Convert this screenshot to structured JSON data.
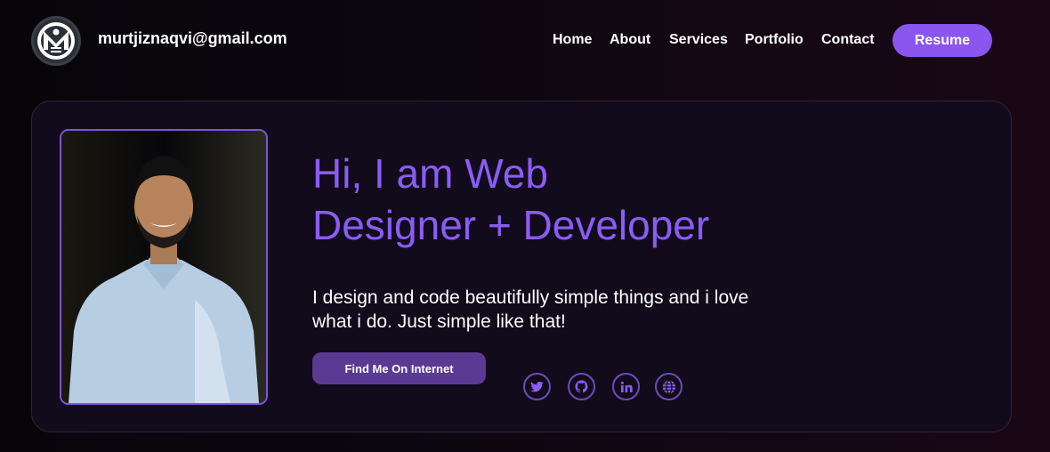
{
  "header": {
    "logo_icon": "mn-monogram-logo",
    "email": "murtjiznaqvi@gmail.com",
    "nav": [
      {
        "label": "Home"
      },
      {
        "label": "About"
      },
      {
        "label": "Services"
      },
      {
        "label": "Portfolio"
      },
      {
        "label": "Contact"
      }
    ],
    "resume_label": "Resume"
  },
  "hero": {
    "photo": "profile-photo",
    "headline_line1": "Hi, I am Web",
    "headline_line2": "Designer + Developer",
    "intro_line1": "I design and code beautifully simple things and i love",
    "intro_line2": "what i do. Just simple like that!",
    "find_button_label": "Find Me On Internet",
    "social_icons": [
      "twitter-icon",
      "github-icon",
      "linkedin-icon",
      "globe-icon"
    ]
  },
  "colors": {
    "accent": "#8b5cf6",
    "button_accent": "#8b55f0",
    "secondary_button": "#5b3a94",
    "card_bg": "#110b1c"
  }
}
